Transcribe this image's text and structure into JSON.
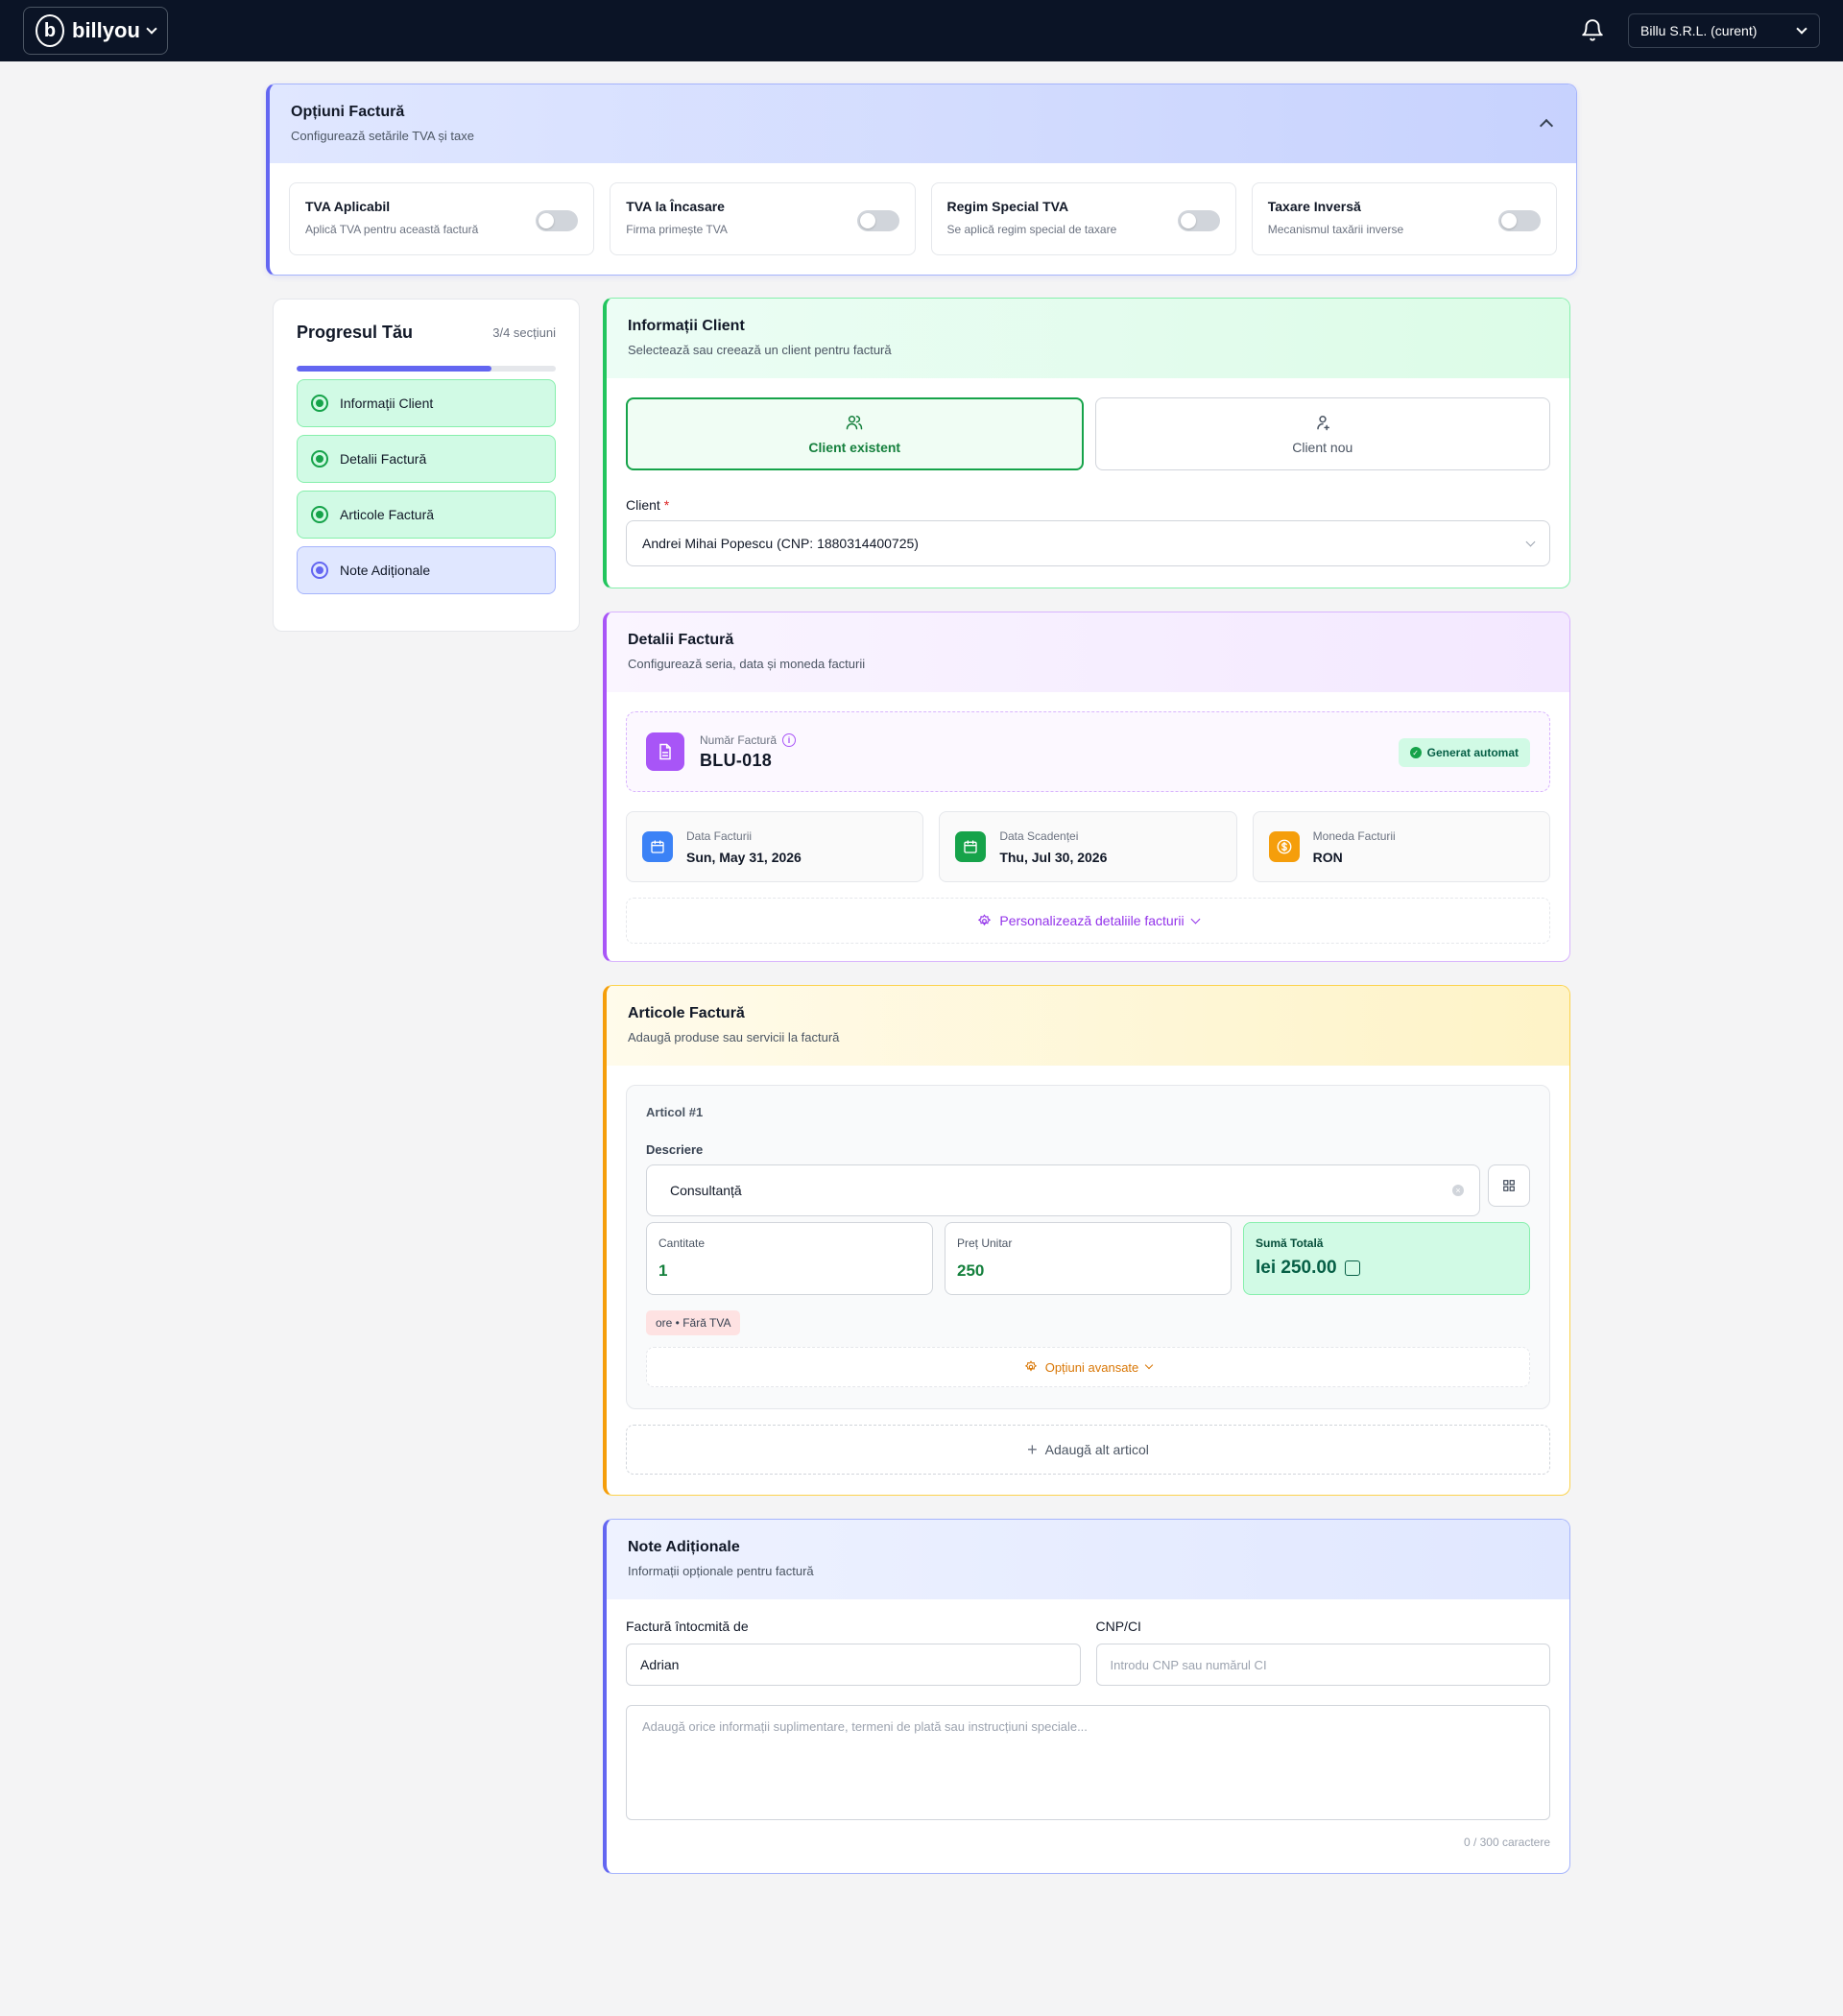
{
  "header": {
    "brand": "billyou",
    "logo_letter": "b",
    "company": "Billu S.R.L. (curent)"
  },
  "options": {
    "title": "Opțiuni Factură",
    "subtitle": "Configurează setările TVA și taxe",
    "toggles": [
      {
        "title": "TVA Aplicabil",
        "subtitle": "Aplică TVA pentru această factură",
        "on": false
      },
      {
        "title": "TVA la Încasare",
        "subtitle": "Firma primește TVA",
        "on": false
      },
      {
        "title": "Regim Special TVA",
        "subtitle": "Se aplică regim special de taxare",
        "on": false
      },
      {
        "title": "Taxare Inversă",
        "subtitle": "Mecanismul taxării inverse",
        "on": false
      }
    ]
  },
  "progress": {
    "title": "Progresul Tău",
    "count": "3/4 secțiuni",
    "fraction": 0.75,
    "steps": [
      {
        "label": "Informații Client",
        "state": "done"
      },
      {
        "label": "Detalii Factură",
        "state": "done"
      },
      {
        "label": "Articole Factură",
        "state": "done"
      },
      {
        "label": "Note Adiționale",
        "state": "active"
      }
    ]
  },
  "client": {
    "title": "Informații Client",
    "subtitle": "Selectează sau creează un client pentru factură",
    "existing_label": "Client existent",
    "new_label": "Client nou",
    "field_label": "Client",
    "required": "*",
    "value": "Andrei Mihai Popescu (CNP: 1880314400725)"
  },
  "details": {
    "title": "Detalii Factură",
    "subtitle": "Configurează seria, data și moneda facturii",
    "number_label": "Număr Factură",
    "number_value": "BLU-018",
    "auto_badge": "Generat automat",
    "invoice_date_label": "Data Facturii",
    "invoice_date": "Sun, May 31, 2026",
    "due_date_label": "Data Scadenței",
    "due_date": "Thu, Jul 30, 2026",
    "currency_label": "Moneda Facturii",
    "currency": "RON",
    "customize_label": "Personalizează detaliile facturii"
  },
  "items": {
    "title": "Articole Factură",
    "subtitle": "Adaugă produse sau servicii la factură",
    "item_title": "Articol #1",
    "desc_label": "Descriere",
    "desc_value": "Consultanță",
    "qty_label": "Cantitate",
    "qty_value": "1",
    "price_label": "Preț Unitar",
    "price_value": "250",
    "total_label": "Sumă Totală",
    "total_value": "lei 250.00",
    "tag": "ore • Fără TVA",
    "advanced_label": "Opțiuni avansate",
    "add_label": "Adaugă alt articol"
  },
  "notes": {
    "title": "Note Adiționale",
    "subtitle": "Informații opționale pentru factură",
    "issued_by_label": "Factură întocmită de",
    "issued_by_value": "Adrian",
    "cnp_label": "CNP/CI",
    "cnp_placeholder": "Introdu CNP sau numărul CI",
    "notes_placeholder": "Adaugă orice informații suplimentare, termeni de plată sau instrucțiuni speciale...",
    "counter": "0 / 300 caractere"
  },
  "colors": {
    "nav_bg": "#0b1426",
    "indigo": "#6366f1",
    "green": "#16a34a",
    "purple": "#a855f7",
    "amber": "#f59e0b",
    "blue": "#3b82f6"
  }
}
